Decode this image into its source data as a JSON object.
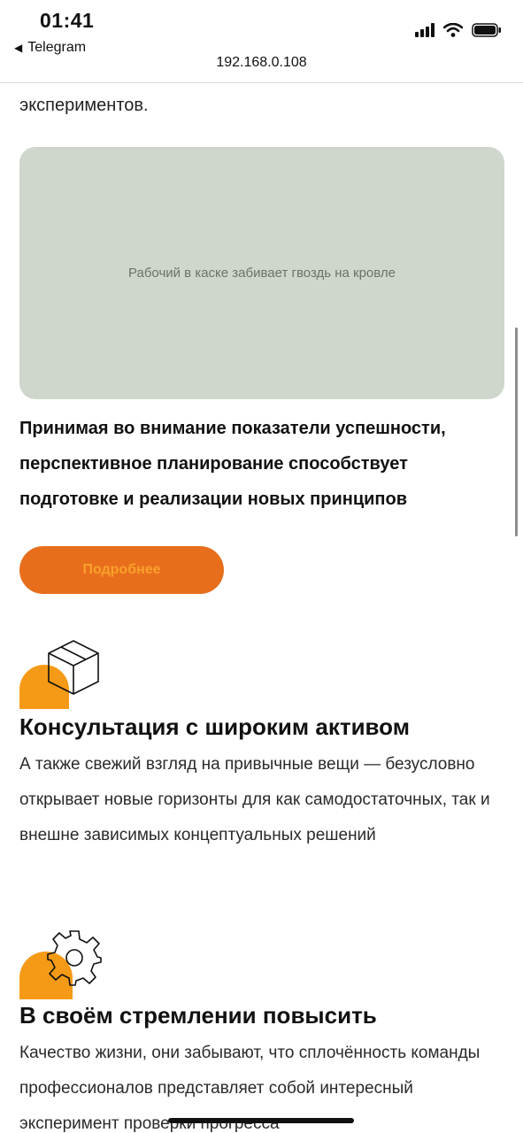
{
  "status_bar": {
    "time": "01:41",
    "back_label": "Telegram",
    "url": "192.168.0.108"
  },
  "article": {
    "prev_text_tail": "экспериментов.",
    "image_alt": "Рабочий в каске забивает гвоздь на кровле",
    "highlight_text": "Принимая во внимание показатели успешности, перспективное планирование способствует подготовке и реализации новых принципов",
    "button_label": "Подробнее"
  },
  "features": [
    {
      "icon": "box-icon",
      "title": "Консультация с широким активом",
      "text": "А также свежий взгляд на привычные вещи — безусловно открывает новые горизонты для как самодостаточных, так и внешне зависимых концептуальных решений"
    },
    {
      "icon": "gear-icon",
      "title": "В своём стремлении повысить",
      "text": "Качество жизни, они забывают, что сплочённость команды профессионалов представляет собой интересный эксперимент проверки прогресса"
    }
  ],
  "colors": {
    "accent": "#e86e1c",
    "accent_text": "#f9a12a",
    "blob": "#f59a16"
  }
}
